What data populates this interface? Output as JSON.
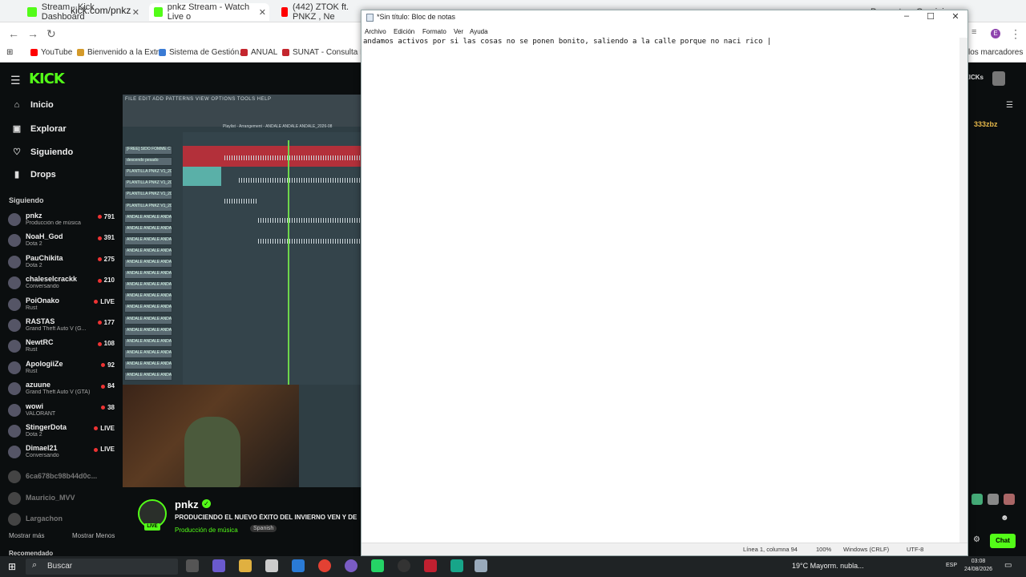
{
  "browser": {
    "tabs": [
      {
        "title": "Stream - Kick Dashboard",
        "color": "#53fc18"
      },
      {
        "title": "pnkz Stream - Watch Live o",
        "color": "#53fc18"
      },
      {
        "title": "(442) ZTOK ft. PNKZ , Ne",
        "color": "#ff0000"
      }
    ],
    "right_tab": "Pregunta a Gemini",
    "url": "kick.com/pnkz",
    "bookmarks": [
      {
        "label": "YouTube",
        "color": "#ff0000"
      },
      {
        "label": "Bienvenido a la Extr...",
        "color": "#d49a2a"
      },
      {
        "label": "Sistema de Gestión...",
        "color": "#3a7bd5"
      },
      {
        "label": "ANUAL",
        "color": "#c4262e"
      },
      {
        "label": "SUNAT - Consulta R...",
        "color": "#c4262e"
      }
    ],
    "bookmarks_right": "los marcadores"
  },
  "kick": {
    "logo": "KICK",
    "nav": [
      {
        "label": "Inicio",
        "icon": "home-icon",
        "glyph": "⌂"
      },
      {
        "label": "Explorar",
        "icon": "compass-icon",
        "glyph": "▣"
      },
      {
        "label": "Siguiendo",
        "icon": "heart-icon",
        "glyph": "♡"
      },
      {
        "label": "Drops",
        "icon": "drops-icon",
        "glyph": "▮"
      }
    ],
    "following_title": "Siguiendo",
    "channels": [
      {
        "name": "pnkz",
        "category": "Producción de música",
        "viewers": "791"
      },
      {
        "name": "NoaH_God",
        "category": "Dota 2",
        "viewers": "391"
      },
      {
        "name": "PauChikita",
        "category": "Dota 2",
        "viewers": "275"
      },
      {
        "name": "chaleselcrackk",
        "category": "Conversando",
        "viewers": "210"
      },
      {
        "name": "PoiOnako",
        "category": "Rust",
        "viewers": "LIVE"
      },
      {
        "name": "RASTAS",
        "category": "Grand Theft Auto V (G...",
        "viewers": "177"
      },
      {
        "name": "NewtRC",
        "category": "Rust",
        "viewers": "108"
      },
      {
        "name": "ApologiiZe",
        "category": "Rust",
        "viewers": "92"
      },
      {
        "name": "azuune",
        "category": "Grand Theft Auto V (GTA)",
        "viewers": "84"
      },
      {
        "name": "wowi",
        "category": "VALORANT",
        "viewers": "38"
      },
      {
        "name": "StingerDota",
        "category": "Dota 2",
        "viewers": "LIVE"
      },
      {
        "name": "Dimael21",
        "category": "Conversando",
        "viewers": "LIVE"
      }
    ],
    "offline": [
      "6ca678bc98b44d0c...",
      "Mauricio_MVV",
      "Largachon"
    ],
    "show_more": "Mostrar más",
    "show_less": "Mostrar Menos",
    "recommended": "Recomendado",
    "stream": {
      "name": "pnkz",
      "title": "PRODUCIENDO EL NUEVO ÉXITO DEL INVIERNO VEN Y DE",
      "category": "Producción de música",
      "language": "Spanish",
      "live": "LIVE"
    },
    "fl_menu": "FILE EDIT ADD PATTERNS VIEW OPTIONS TOOLS HELP",
    "fl_playlist": "Playlist - Arrangement - ANDALE ANDALE ANDALE_2026-08",
    "fl_tracks": [
      "[FREE] SIDO FOMME C",
      "descendo pesado",
      "PLANTILLA PNKZ V1_2026",
      "PLANTILLA PNKZ V1_2026",
      "PLANTILLA PNKZ V1_2026",
      "PLANTILLA PNKZ V1_2026",
      "ANDALE ANDALE ANDALE",
      "ANDALE ANDALE ANDALE",
      "ANDALE ANDALE ANDALE",
      "ANDALE ANDALE ANDALE",
      "ANDALE ANDALE ANDALE",
      "ANDALE ANDALE ANDALE",
      "ANDALE ANDALE ANDALE",
      "ANDALE ANDALE ANDALE",
      "ANDALE ANDALE ANDALE",
      "ANDALE ANDALE ANDALE",
      "ANDALE ANDALE ANDALE",
      "ANDALE ANDALE ANDALE",
      "ANDALE ANDALE ANDALE",
      "ANDALE ANDALE ANDALE",
      "ANDALE ANDALE ANDALE"
    ],
    "chat_user": "333zbz",
    "kicks": "KICKs",
    "chat_button": "Chat"
  },
  "notepad": {
    "title": "*Sin título: Bloc de notas",
    "menu": [
      "Archivo",
      "Edición",
      "Formato",
      "Ver",
      "Ayuda"
    ],
    "text": "andamos activos por si las cosas no se ponen bonito, saliendo a la calle porque no naci rico |",
    "status": {
      "position": "Línea 1, columna 94",
      "zoom": "100%",
      "eol": "Windows (CRLF)",
      "encoding": "UTF-8"
    }
  },
  "taskbar": {
    "search": "Buscar",
    "weather": "19°C  Mayorm. nubla...",
    "lang": "ESP",
    "time": "03:08",
    "date": "24/08/2026"
  }
}
